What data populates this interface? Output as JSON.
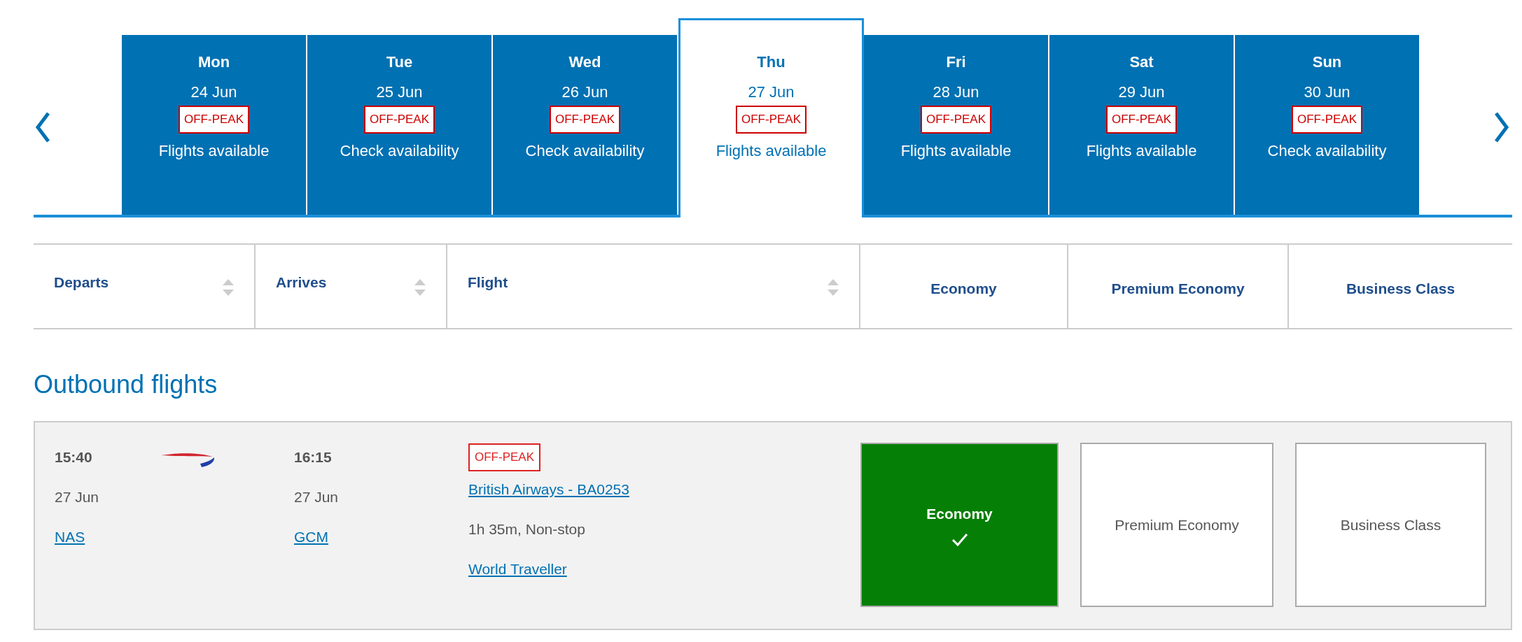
{
  "date_strip": {
    "days": [
      {
        "day": "Mon",
        "date": "24 Jun",
        "badge": "OFF-PEAK",
        "availability": "Flights available",
        "selected": false
      },
      {
        "day": "Tue",
        "date": "25 Jun",
        "badge": "OFF-PEAK",
        "availability": "Check availability",
        "selected": false
      },
      {
        "day": "Wed",
        "date": "26 Jun",
        "badge": "OFF-PEAK",
        "availability": "Check availability",
        "selected": false
      },
      {
        "day": "Thu",
        "date": "27 Jun",
        "badge": "OFF-PEAK",
        "availability": "Flights available",
        "selected": true
      },
      {
        "day": "Fri",
        "date": "28 Jun",
        "badge": "OFF-PEAK",
        "availability": "Flights available",
        "selected": false
      },
      {
        "day": "Sat",
        "date": "29 Jun",
        "badge": "OFF-PEAK",
        "availability": "Flights available",
        "selected": false
      },
      {
        "day": "Sun",
        "date": "30 Jun",
        "badge": "OFF-PEAK",
        "availability": "Check availability",
        "selected": false
      }
    ]
  },
  "table": {
    "columns": [
      {
        "label": "Departs",
        "kind": "sortable"
      },
      {
        "label": "Arrives",
        "kind": "sortable"
      },
      {
        "label": "Flight",
        "kind": "sortable"
      },
      {
        "label": "Economy",
        "kind": "cabin"
      },
      {
        "label": "Premium Economy",
        "kind": "cabin"
      },
      {
        "label": "Business Class",
        "kind": "cabin"
      }
    ]
  },
  "section_title": "Outbound flights",
  "flights": [
    {
      "depart": {
        "time": "15:40",
        "date": "27 Jun",
        "airport": "NAS"
      },
      "arrive": {
        "time": "16:15",
        "date": "27 Jun",
        "airport": "GCM"
      },
      "badge": "OFF-PEAK",
      "flight": "British Airways - BA0253",
      "duration": "1h 35m, Non-stop",
      "cabin": "World Traveller",
      "fares": [
        {
          "label": "Economy",
          "selected": true
        },
        {
          "label": "Premium Economy",
          "selected": false
        },
        {
          "label": "Business Class",
          "selected": false
        }
      ]
    }
  ]
}
